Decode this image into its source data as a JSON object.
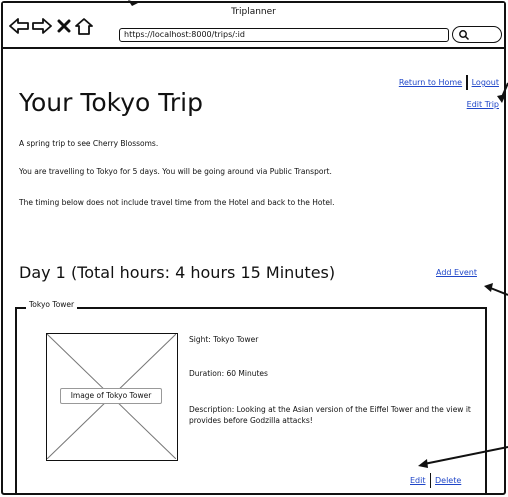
{
  "browser": {
    "window_title": "Triplanner",
    "url": "https://localhost:8000/trips/:id"
  },
  "header": {
    "return_home": "Return to Home",
    "logout": "Logout",
    "edit_trip": "Edit Trip"
  },
  "page": {
    "title": "Your Tokyo Trip",
    "paragraphs": [
      "A spring trip to see Cherry Blossoms.",
      "You are travelling to Tokyo for 5 days. You will be going around via Public Transport.",
      "The timing below does not include travel time from the Hotel and back to the Hotel."
    ]
  },
  "day": {
    "heading": "Day 1 (Total hours: 4 hours 15 Minutes)",
    "add_event": "Add Event",
    "events": [
      {
        "name": "Tokyo Tower",
        "image_label": "Image of Tokyo Tower",
        "sight": "Sight: Tokyo Tower",
        "duration": "Duration: 60 Minutes",
        "description": "Description: Looking at the Asian version of the Eiffel Tower and the view it provides before Godzilla attacks!",
        "edit": "Edit",
        "delete": "Delete"
      }
    ]
  },
  "icons": [
    "back-arrow-icon",
    "forward-arrow-icon",
    "close-icon",
    "home-icon",
    "search-icon"
  ],
  "colors": {
    "link": "#1f46c8",
    "border": "#111111"
  }
}
